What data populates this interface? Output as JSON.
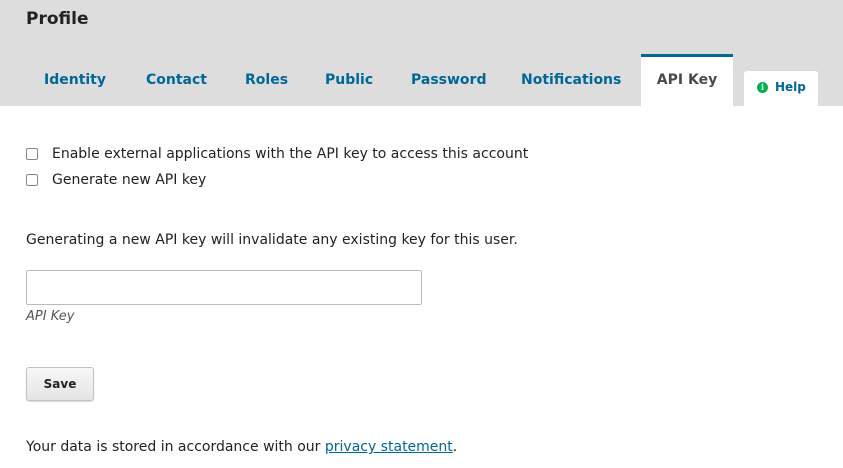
{
  "header": {
    "title": "Profile"
  },
  "tabs": [
    {
      "label": "Identity"
    },
    {
      "label": "Contact"
    },
    {
      "label": "Roles"
    },
    {
      "label": "Public"
    },
    {
      "label": "Password"
    },
    {
      "label": "Notifications"
    },
    {
      "label": "API Key",
      "active": true
    }
  ],
  "help": {
    "label": "Help",
    "icon": "info-icon",
    "icon_color": "#00b24e"
  },
  "form": {
    "enable_external_label": "Enable external applications with the API key to access this account",
    "enable_external_checked": false,
    "generate_new_label": "Generate new API key",
    "generate_new_checked": false,
    "notice": "Generating a new API key will invalidate any existing key for this user.",
    "api_key_value": "",
    "api_key_label": "API Key",
    "save_label": "Save"
  },
  "footer": {
    "privacy_prefix": "Your data is stored in accordance with our ",
    "privacy_link": "privacy statement",
    "privacy_suffix": "."
  },
  "colors": {
    "header_bg": "#dddddd",
    "link": "#006798",
    "active_tab_text": "#4a4a4a"
  }
}
